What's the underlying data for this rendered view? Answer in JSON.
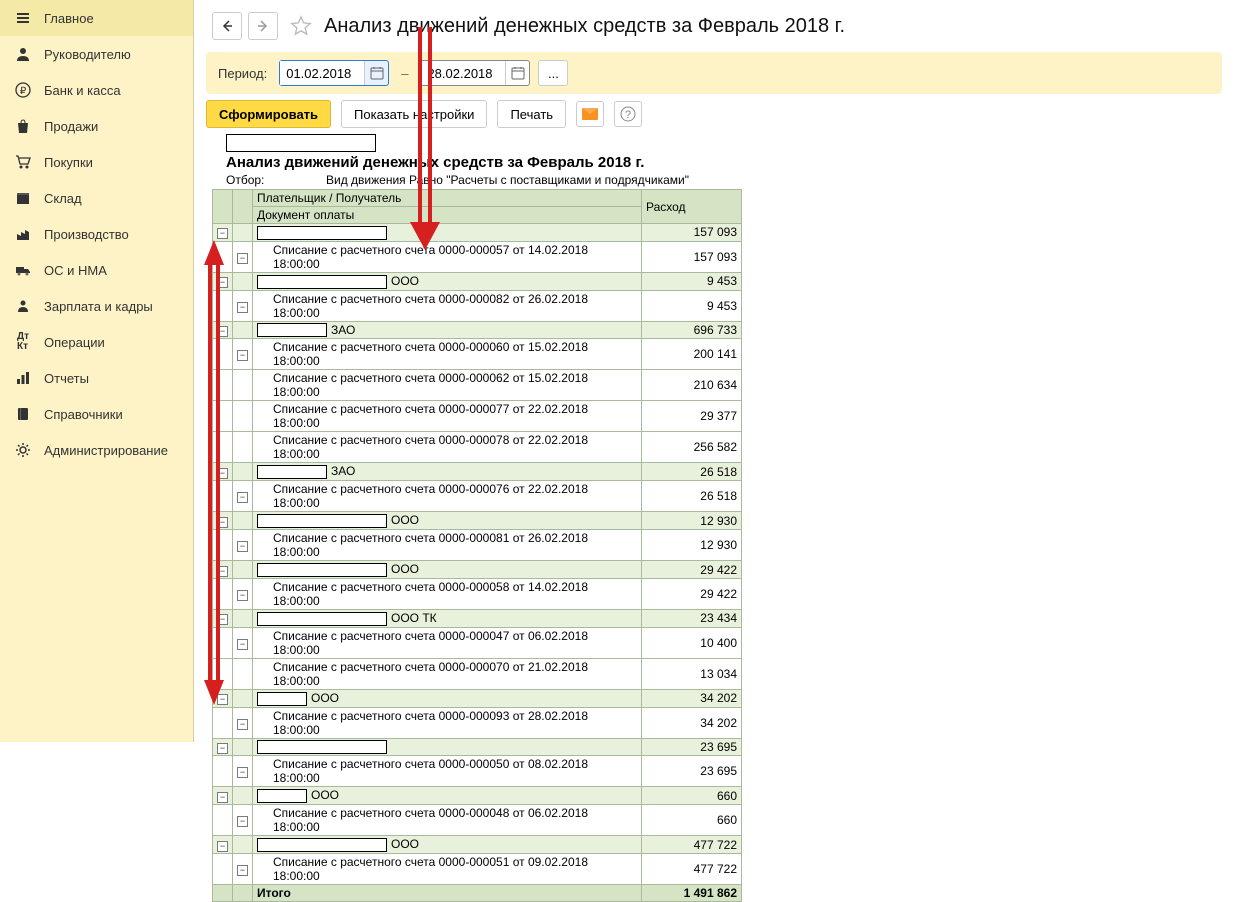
{
  "sidebar": {
    "items": [
      {
        "icon": "menu",
        "label": "Главное"
      },
      {
        "icon": "user",
        "label": "Руководителю"
      },
      {
        "icon": "rub",
        "label": "Банк и касса"
      },
      {
        "icon": "bag",
        "label": "Продажи"
      },
      {
        "icon": "cart",
        "label": "Покупки"
      },
      {
        "icon": "box",
        "label": "Склад"
      },
      {
        "icon": "factory",
        "label": "Производство"
      },
      {
        "icon": "truck",
        "label": "ОС и НМА"
      },
      {
        "icon": "person",
        "label": "Зарплата и кадры"
      },
      {
        "icon": "ops",
        "label": "Операции"
      },
      {
        "icon": "chart",
        "label": "Отчеты"
      },
      {
        "icon": "book",
        "label": "Справочники"
      },
      {
        "icon": "gear",
        "label": "Администрирование"
      }
    ]
  },
  "header": {
    "title": "Анализ движений денежных средств за Февраль 2018 г."
  },
  "period": {
    "label": "Период:",
    "from": "01.02.2018",
    "to": "28.02.2018",
    "sep": "–"
  },
  "toolbar": {
    "generate": "Сформировать",
    "showSettings": "Показать настройки",
    "print": "Печать"
  },
  "report": {
    "title": "Анализ движений денежных средств за Февраль 2018 г.",
    "filterLabel": "Отбор:",
    "filterValue": "Вид движения Равно \"Расчеты с поставщиками и подрядчиками\"",
    "col1": "Плательщик / Получатель",
    "col1b": "Документ оплаты",
    "col2": "Расход",
    "totalLabel": "Итого",
    "totalValue": "1 491 862",
    "groups": [
      {
        "name": "",
        "w": 130,
        "value": "157 093",
        "docs": [
          {
            "text": "Списание с расчетного счета 0000-000057 от 14.02.2018 18:00:00",
            "value": "157 093"
          }
        ]
      },
      {
        "name": "ООО",
        "w": 130,
        "value": "9 453",
        "docs": [
          {
            "text": "Списание с расчетного счета 0000-000082 от 26.02.2018 18:00:00",
            "value": "9 453"
          }
        ]
      },
      {
        "name": "ЗАО",
        "w": 70,
        "value": "696 733",
        "docs": [
          {
            "text": "Списание с расчетного счета 0000-000060 от 15.02.2018 18:00:00",
            "value": "200 141"
          },
          {
            "text": "Списание с расчетного счета 0000-000062 от 15.02.2018 18:00:00",
            "value": "210 634"
          },
          {
            "text": "Списание с расчетного счета 0000-000077 от 22.02.2018 18:00:00",
            "value": "29 377"
          },
          {
            "text": "Списание с расчетного счета 0000-000078 от 22.02.2018 18:00:00",
            "value": "256 582"
          }
        ]
      },
      {
        "name": "ЗАО",
        "w": 70,
        "value": "26 518",
        "docs": [
          {
            "text": "Списание с расчетного счета 0000-000076 от 22.02.2018 18:00:00",
            "value": "26 518"
          }
        ]
      },
      {
        "name": "ООО",
        "w": 130,
        "value": "12 930",
        "docs": [
          {
            "text": "Списание с расчетного счета 0000-000081 от 26.02.2018 18:00:00",
            "value": "12 930"
          }
        ]
      },
      {
        "name": "ООО",
        "w": 130,
        "value": "29 422",
        "docs": [
          {
            "text": "Списание с расчетного счета 0000-000058 от 14.02.2018 18:00:00",
            "value": "29 422"
          }
        ]
      },
      {
        "name": "ООО ТК",
        "w": 130,
        "value": "23 434",
        "docs": [
          {
            "text": "Списание с расчетного счета 0000-000047 от 06.02.2018 18:00:00",
            "value": "10 400"
          },
          {
            "text": "Списание с расчетного счета 0000-000070 от 21.02.2018 18:00:00",
            "value": "13 034"
          }
        ]
      },
      {
        "name": "ООО",
        "w": 50,
        "value": "34 202",
        "docs": [
          {
            "text": "Списание с расчетного счета 0000-000093 от 28.02.2018 18:00:00",
            "value": "34 202"
          }
        ]
      },
      {
        "name": "",
        "w": 130,
        "value": "23 695",
        "docs": [
          {
            "text": "Списание с расчетного счета 0000-000050 от 08.02.2018 18:00:00",
            "value": "23 695"
          }
        ]
      },
      {
        "name": "ООО",
        "w": 50,
        "value": "660",
        "docs": [
          {
            "text": "Списание с расчетного счета 0000-000048 от 06.02.2018 18:00:00",
            "value": "660"
          }
        ]
      },
      {
        "name": "ООО",
        "w": 130,
        "value": "477 722",
        "docs": [
          {
            "text": "Списание с расчетного счета 0000-000051 от 09.02.2018 18:00:00",
            "value": "477 722"
          }
        ]
      }
    ]
  }
}
